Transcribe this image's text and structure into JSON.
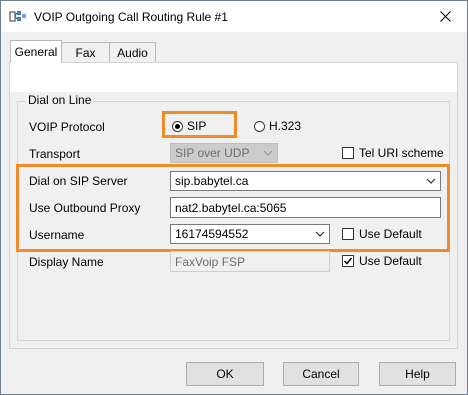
{
  "window": {
    "title": "VOIP Outgoing Call Routing Rule #1"
  },
  "tabs": [
    {
      "label": "General",
      "active": true
    },
    {
      "label": "Fax",
      "active": false
    },
    {
      "label": "Audio",
      "active": false
    }
  ],
  "group": {
    "legend": "Dial on Line",
    "voip_protocol": {
      "label": "VOIP Protocol",
      "options": [
        {
          "label": "SIP",
          "selected": true
        },
        {
          "label": "H.323",
          "selected": false
        }
      ]
    },
    "transport": {
      "label": "Transport",
      "value": "SIP over UDP",
      "enabled": false
    },
    "tel_uri": {
      "label": "Tel URI scheme",
      "checked": false
    },
    "sip_server": {
      "label": "Dial on SIP Server",
      "value": "sip.babytel.ca"
    },
    "outbound_proxy": {
      "label": "Use Outbound Proxy",
      "value": "nat2.babytel.ca:5065"
    },
    "username": {
      "label": "Username",
      "value": "16174594552"
    },
    "username_default": {
      "label": "Use Default",
      "checked": false
    },
    "display_name": {
      "label": "Display Name",
      "value": "FaxVoip FSP",
      "enabled": false
    },
    "display_default": {
      "label": "Use Default",
      "checked": true
    }
  },
  "buttons": {
    "ok": "OK",
    "cancel": "Cancel",
    "help": "Help"
  },
  "colors": {
    "highlight": "#f08a2b"
  }
}
